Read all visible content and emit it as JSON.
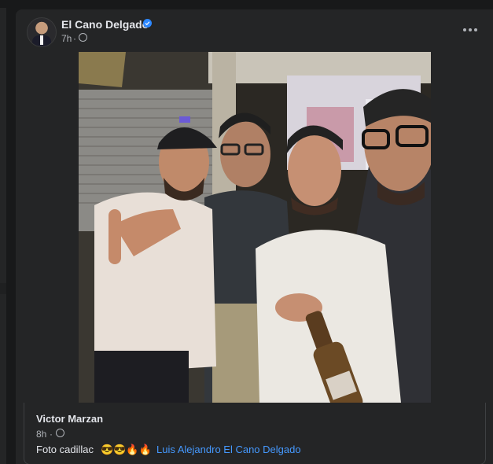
{
  "post": {
    "author": "El Cano Delgado",
    "time": "7h",
    "separator": "·",
    "audience_icon": "globe-icon",
    "verified_icon": "verified-badge-icon",
    "more_icon": "more-options-icon"
  },
  "shared": {
    "author": "Victor Marzan",
    "time": "8h",
    "separator": "·",
    "text": "Foto cadillac",
    "emojis": "😎😎🔥🔥",
    "mention": "Luis Alejandro El Cano Delgado"
  },
  "colors": {
    "background": "#18191a",
    "card": "#242526",
    "primary_text": "#e4e6eb",
    "secondary_text": "#b0b3b8",
    "link": "#4599ff",
    "verified": "#2d88ff"
  }
}
